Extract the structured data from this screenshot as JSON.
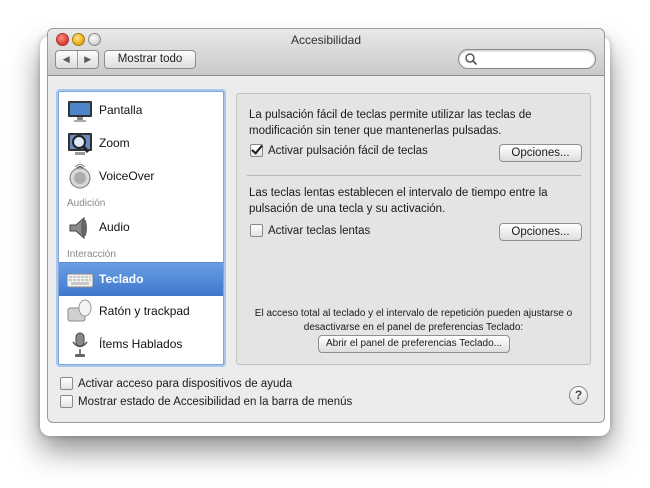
{
  "window": {
    "title": "Accesibilidad"
  },
  "toolbar": {
    "back": "◀",
    "forward": "▶",
    "show_all": "Mostrar todo",
    "search_placeholder": ""
  },
  "sidebar": {
    "items": [
      {
        "label": "Pantalla",
        "icon": "display-icon"
      },
      {
        "label": "Zoom",
        "icon": "zoom-icon"
      },
      {
        "label": "VoiceOver",
        "icon": "voiceover-icon"
      },
      {
        "label": "Audio",
        "icon": "speaker-icon"
      },
      {
        "label": "Teclado",
        "icon": "keyboard-icon",
        "selected": true
      },
      {
        "label": "Ratón y trackpad",
        "icon": "mouse-icon"
      },
      {
        "label": "Ítems Hablados",
        "icon": "microphone-icon"
      }
    ],
    "groups": {
      "audio": "Audición",
      "interaction": "Interacción"
    }
  },
  "panel": {
    "sticky_desc": "La pulsación fácil de teclas permite utilizar las teclas de modificación sin tener que mantenerlas pulsadas.",
    "sticky_check": "Activar pulsación fácil de teclas",
    "sticky_checked": true,
    "options_label": "Opciones...",
    "slow_desc": "Las teclas lentas establecen el intervalo de tiempo entre la pulsación de una tecla y su activación.",
    "slow_check": "Activar teclas lentas",
    "slow_checked": false,
    "note": "El acceso total al teclado y el intervalo de repetición pueden ajustarse o desactivarse en el panel de preferencias Teclado:",
    "open_prefs": "Abrir el panel de preferencias Teclado..."
  },
  "bottom": {
    "assistive": "Activar acceso para dispositivos de ayuda",
    "menubar": "Mostrar estado de Accesibilidad en la barra de menús",
    "help": "?"
  },
  "colors": {
    "selection": "#4a84d8",
    "window": "#ececec",
    "panel": "#e4e4e4"
  }
}
